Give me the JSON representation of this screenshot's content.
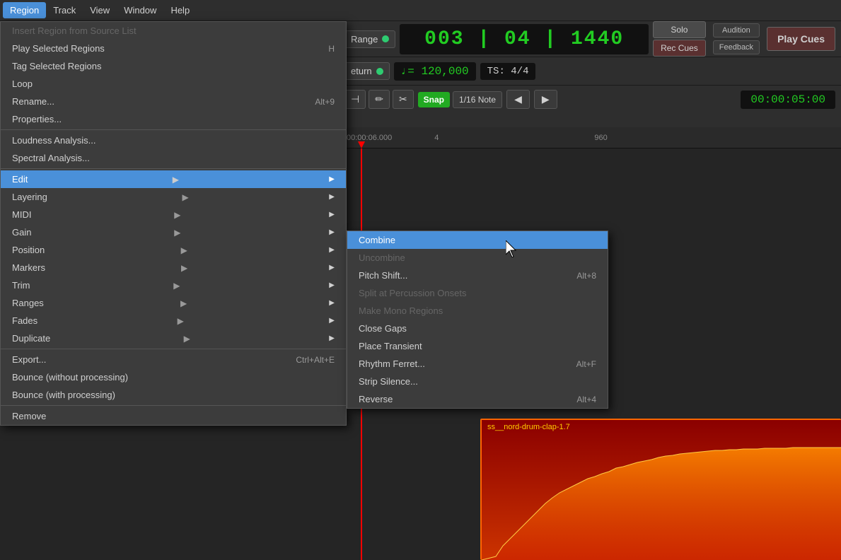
{
  "menubar": {
    "items": [
      "Region",
      "Track",
      "View",
      "Window",
      "Help"
    ]
  },
  "transport": {
    "timecode": "003 | 04 | 1440",
    "bpm_label": "♩= 120,000",
    "ts_label": "TS:  4/4",
    "time_position": "00:00:05:00",
    "range_label": "Range",
    "return_label": "eturn",
    "solo_label": "Solo",
    "audition_label": "Audition",
    "feedback_label": "Feedback",
    "rec_cues_label": "Rec Cues",
    "play_cues_label": "Play Cues",
    "snap_label": "Snap",
    "snap_value": "1/16 Note"
  },
  "region_menu": {
    "items": [
      {
        "label": "Insert Region from Source List",
        "shortcut": "",
        "disabled": true,
        "has_sub": false
      },
      {
        "label": "Play Selected Regions",
        "shortcut": "H",
        "disabled": false,
        "has_sub": false
      },
      {
        "label": "Tag Selected Regions",
        "shortcut": "",
        "disabled": false,
        "has_sub": false
      },
      {
        "label": "Loop",
        "shortcut": "",
        "disabled": false,
        "has_sub": false
      },
      {
        "label": "Rename...",
        "shortcut": "Alt+9",
        "disabled": false,
        "has_sub": false
      },
      {
        "label": "Properties...",
        "shortcut": "",
        "disabled": false,
        "has_sub": false
      },
      {
        "label": "Loudness Analysis...",
        "shortcut": "",
        "disabled": false,
        "has_sub": false
      },
      {
        "label": "Spectral Analysis...",
        "shortcut": "",
        "disabled": false,
        "has_sub": false
      },
      {
        "label": "Edit",
        "shortcut": "",
        "disabled": false,
        "has_sub": true,
        "active": true
      },
      {
        "label": "Layering",
        "shortcut": "",
        "disabled": false,
        "has_sub": true
      },
      {
        "label": "MIDI",
        "shortcut": "",
        "disabled": false,
        "has_sub": true
      },
      {
        "label": "Gain",
        "shortcut": "",
        "disabled": false,
        "has_sub": true
      },
      {
        "label": "Position",
        "shortcut": "",
        "disabled": false,
        "has_sub": true
      },
      {
        "label": "Markers",
        "shortcut": "",
        "disabled": false,
        "has_sub": true
      },
      {
        "label": "Trim",
        "shortcut": "",
        "disabled": false,
        "has_sub": true
      },
      {
        "label": "Ranges",
        "shortcut": "",
        "disabled": false,
        "has_sub": true
      },
      {
        "label": "Fades",
        "shortcut": "",
        "disabled": false,
        "has_sub": true
      },
      {
        "label": "Duplicate",
        "shortcut": "",
        "disabled": false,
        "has_sub": true
      },
      {
        "label": "Export...",
        "shortcut": "Ctrl+Alt+E",
        "disabled": false,
        "has_sub": false
      },
      {
        "label": "Bounce (without processing)",
        "shortcut": "",
        "disabled": false,
        "has_sub": false
      },
      {
        "label": "Bounce (with processing)",
        "shortcut": "",
        "disabled": false,
        "has_sub": false
      },
      {
        "label": "Remove",
        "shortcut": "",
        "disabled": false,
        "has_sub": false
      }
    ]
  },
  "edit_submenu": {
    "items": [
      {
        "label": "Combine",
        "shortcut": "",
        "disabled": false,
        "active": true
      },
      {
        "label": "Uncombine",
        "shortcut": "",
        "disabled": true
      },
      {
        "label": "Pitch Shift...",
        "shortcut": "Alt+8",
        "disabled": false
      },
      {
        "label": "Split at Percussion Onsets",
        "shortcut": "",
        "disabled": true
      },
      {
        "label": "Make Mono Regions",
        "shortcut": "",
        "disabled": true
      },
      {
        "label": "Close Gaps",
        "shortcut": "",
        "disabled": false
      },
      {
        "label": "Place Transient",
        "shortcut": "",
        "disabled": false
      },
      {
        "label": "Rhythm Ferret...",
        "shortcut": "Alt+F",
        "disabled": false
      },
      {
        "label": "Strip Silence...",
        "shortcut": "",
        "disabled": false
      },
      {
        "label": "Reverse",
        "shortcut": "Alt+4",
        "disabled": false
      }
    ]
  },
  "waveform": {
    "label": "ss__nord-drum-clap-1.7"
  },
  "ruler": {
    "time_label": "00:00:06.000",
    "beat_label": "4",
    "beat2_label": "960"
  }
}
